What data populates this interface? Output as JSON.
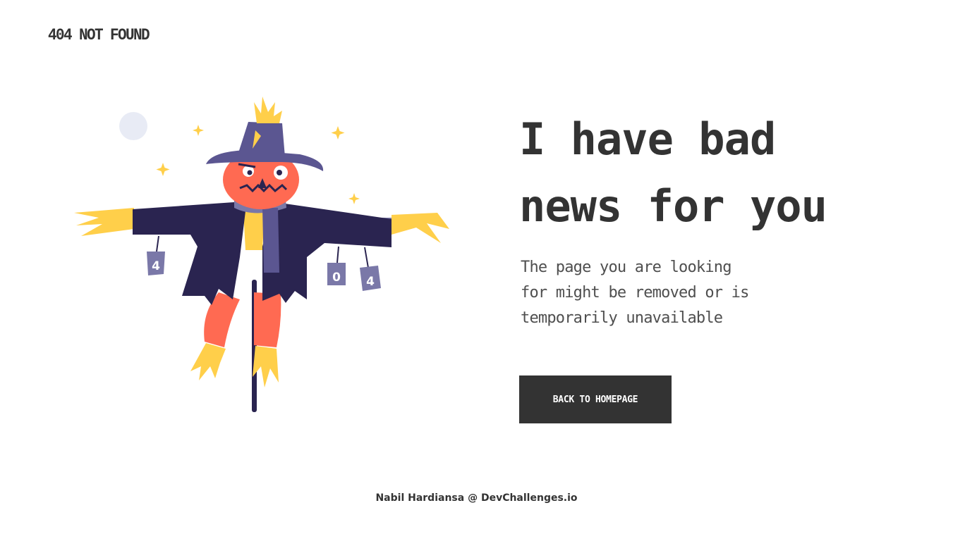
{
  "header": {
    "brand": "404 NOT FOUND"
  },
  "main": {
    "heading_line1": "I have bad",
    "heading_line2": "news for you",
    "description_lines": [
      "The page you are looking",
      "for might be removed or is",
      "temporarily unavailable"
    ],
    "cta_label": "BACK TO HOMEPAGE"
  },
  "illustration": {
    "can_labels": [
      "4",
      "0",
      "4"
    ]
  },
  "footer": {
    "author": "Nabil Hardiansa",
    "separator": "@",
    "site": "DevChallenges.io"
  },
  "colors": {
    "text": "#333333",
    "button_bg": "#333333",
    "button_text": "#ffffff",
    "hat": "#5b5691",
    "coat": "#2a2450",
    "pumpkin": "#ff6a52",
    "straw": "#ffcf4a",
    "moon": "#e8ebf5"
  }
}
